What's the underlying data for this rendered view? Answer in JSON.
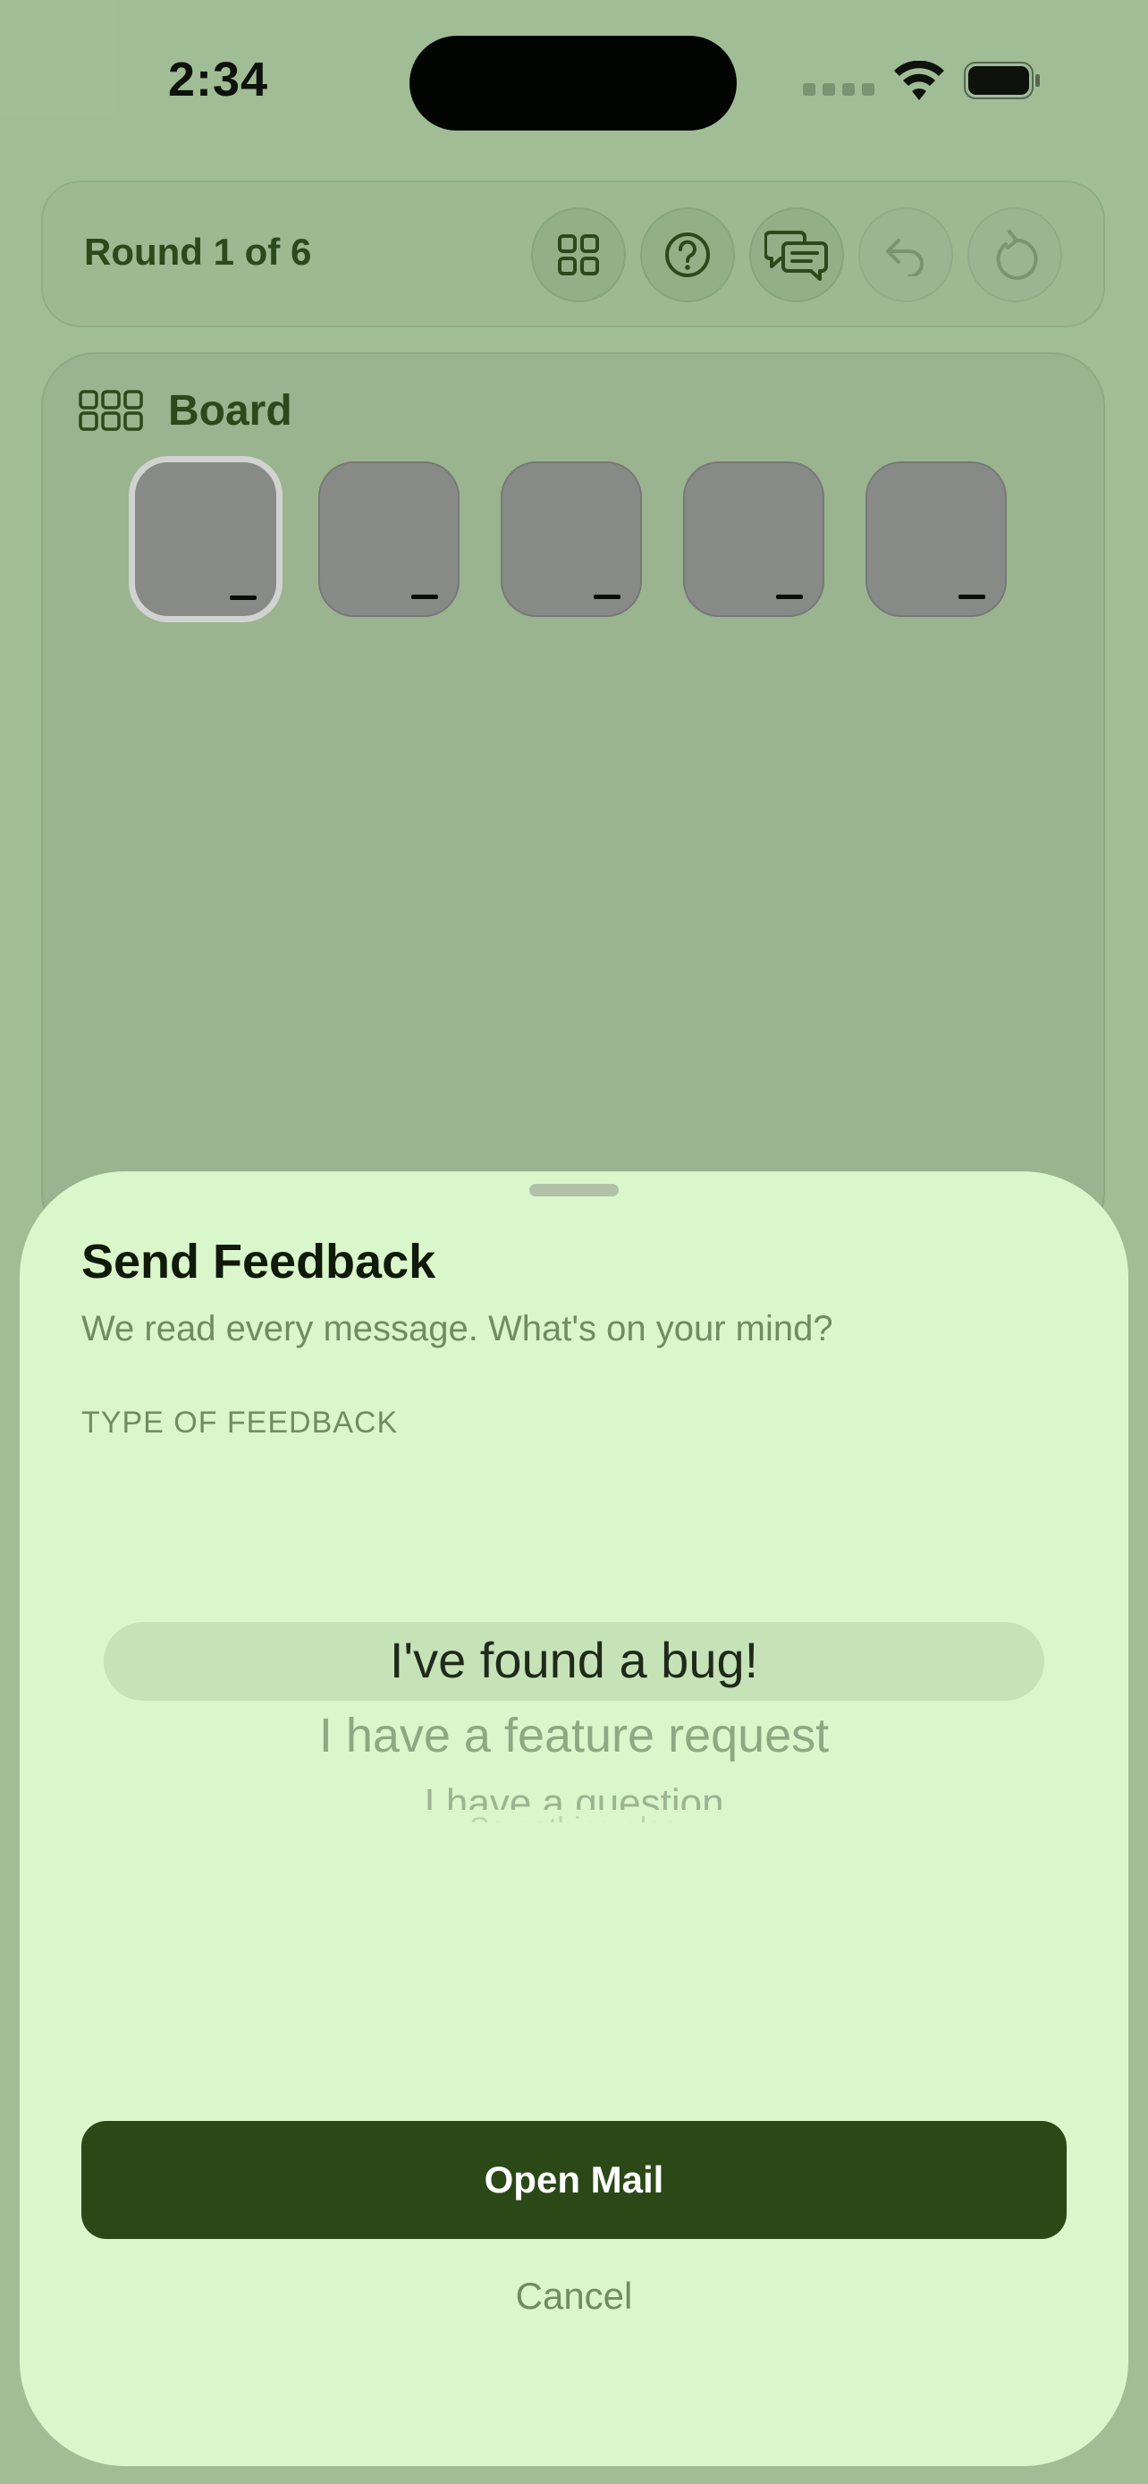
{
  "status_bar": {
    "time": "2:34"
  },
  "header": {
    "round_label": "Round 1 of 6",
    "buttons": [
      {
        "icon": "grid-icon"
      },
      {
        "icon": "help-icon"
      },
      {
        "icon": "feedback-icon"
      },
      {
        "icon": "undo-icon"
      },
      {
        "icon": "restart-icon"
      }
    ]
  },
  "board": {
    "title": "Board",
    "tile_count": 5,
    "selected_tile": 1
  },
  "sheet": {
    "title": "Send Feedback",
    "subtitle": "We read every message. What's on your mind?",
    "section_label": "TYPE OF FEEDBACK",
    "picker": {
      "selected": "I've found a bug!",
      "options": [
        "I've found a bug!",
        "I have a feature request",
        "I have a question",
        "Something else"
      ]
    },
    "primary_button": "Open Mail",
    "cancel_button": "Cancel"
  },
  "colors": {
    "background": "#a9c59e",
    "sheet": "#daf7cb",
    "primary": "#2b4817",
    "muted_text": "#6f8c63"
  }
}
